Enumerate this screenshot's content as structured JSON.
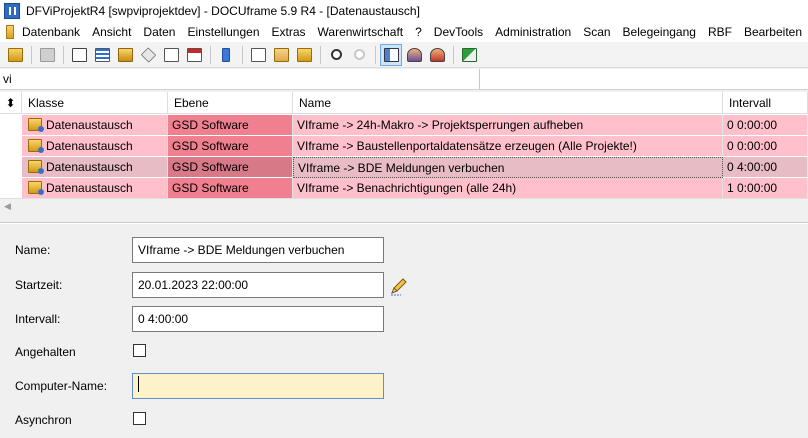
{
  "window": {
    "title": "DFViProjektR4 [swpviprojektdev] - DOCUframe 5.9 R4 - [Datenaustausch]"
  },
  "menu": [
    "Datenbank",
    "Ansicht",
    "Daten",
    "Einstellungen",
    "Extras",
    "Warenwirtschaft",
    "?",
    "DevTools",
    "Administration",
    "Scan",
    "Belegeingang",
    "RBF",
    "Bearbeiten"
  ],
  "filter": {
    "value": "vi"
  },
  "grid": {
    "columns": [
      "Klasse",
      "Ebene",
      "Name",
      "Intervall"
    ],
    "rows": [
      {
        "klasse": "Datenaustausch",
        "ebene": "GSD Software",
        "name": "VIframe -> 24h-Makro -> Projektsperrungen aufheben",
        "intervall": "0 0:00:00"
      },
      {
        "klasse": "Datenaustausch",
        "ebene": "GSD Software",
        "name": "VIframe -> Baustellenportaldatensätze erzeugen (Alle Projekte!)",
        "intervall": "0 0:00:00"
      },
      {
        "klasse": "Datenaustausch",
        "ebene": "GSD Software",
        "name": "VIframe -> BDE Meldungen verbuchen",
        "intervall": "0 4:00:00"
      },
      {
        "klasse": "Datenaustausch",
        "ebene": "GSD Software",
        "name": "VIframe -> Benachrichtigungen (alle 24h)",
        "intervall": "1 0:00:00"
      }
    ],
    "selected_row": 2
  },
  "form": {
    "name_label": "Name:",
    "name_value": "VIframe -> BDE Meldungen verbuchen",
    "startzeit_label": "Startzeit:",
    "startzeit_value": "20.01.2023 22:00:00",
    "intervall_label": "Intervall:",
    "intervall_value": "0 4:00:00",
    "angehalten_label": "Angehalten",
    "computer_label": "Computer-Name:",
    "computer_value": "",
    "asynchron_label": "Asynchron"
  }
}
